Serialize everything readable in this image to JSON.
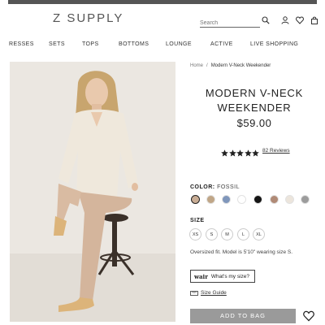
{
  "header": {
    "logo": "Z SUPPLY",
    "search_placeholder": "Search",
    "icons": [
      "search-icon",
      "user-icon",
      "heart-icon",
      "bag-icon"
    ]
  },
  "nav": {
    "items": [
      {
        "label": "RESSES"
      },
      {
        "label": "SETS"
      },
      {
        "label": "TOPS"
      },
      {
        "label": "BOTTOMS"
      },
      {
        "label": "LOUNGE"
      },
      {
        "label": "ACTIVE"
      },
      {
        "label": "LIVE SHOPPING"
      }
    ]
  },
  "breadcrumb": {
    "home": "Home",
    "separator": "/",
    "current": "Modern V-Neck Weekender"
  },
  "product": {
    "title_line1": "MODERN V-NECK",
    "title_line2": "WEEKENDER",
    "price": "$59.00",
    "rating": 5,
    "reviews": "82 Reviews",
    "color_label": "COLOR:",
    "color_value": "FOSSIL",
    "swatches": [
      "#c9ad95",
      "#c0a687",
      "#7f96bb",
      "#ffffff",
      "#151515",
      "#b08a76",
      "#ece5dc",
      "#9c9c9c"
    ],
    "selected_swatch": 0,
    "size_label": "SIZE",
    "sizes": [
      "XS",
      "S",
      "M",
      "L",
      "XL"
    ],
    "fit_note": "Oversized fit. Model is 5'10\" wearing size S.",
    "wair_brand": "wair",
    "wair_text": "What's my size?",
    "size_guide": "Size Guide",
    "add_to_bag": "ADD TO BAG"
  },
  "colors": {
    "button_bg": "#9a9a9a",
    "star": "#222222"
  }
}
